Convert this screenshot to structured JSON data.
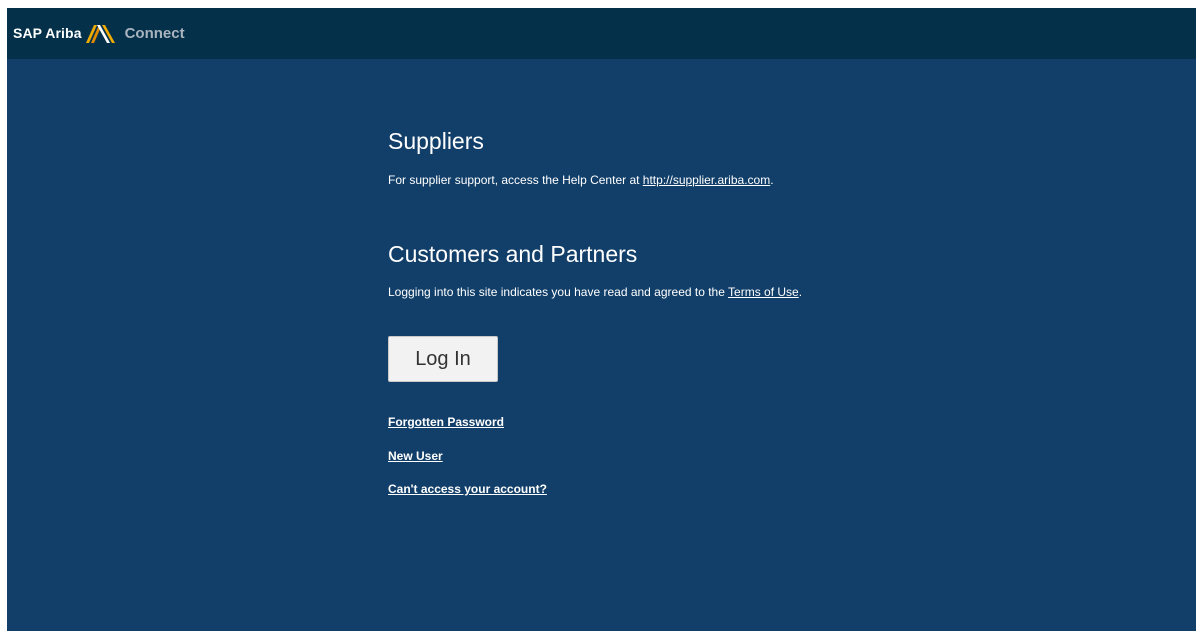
{
  "header": {
    "brand_name": "SAP Ariba",
    "logo_icon": "ariba-chevron-logo-icon",
    "product_name": "Connect",
    "colors": {
      "topbar": "#04304a",
      "logo_gold": "#f0ab00",
      "product_text": "#a9b4be"
    }
  },
  "main": {
    "background": "#123f69",
    "suppliers": {
      "title": "Suppliers",
      "text_prefix": "For supplier support, access the Help Center at ",
      "link_text": "http://supplier.ariba.com",
      "text_suffix": "."
    },
    "customers": {
      "title": "Customers and Partners",
      "text_prefix": "Logging into this site indicates you have read and agreed to the ",
      "link_text": "Terms of Use",
      "text_suffix": "."
    },
    "login_button_label": "Log In",
    "links": {
      "forgot_password": "Forgotten Password",
      "new_user": "New User",
      "cant_access": "Can't access your account?"
    }
  }
}
